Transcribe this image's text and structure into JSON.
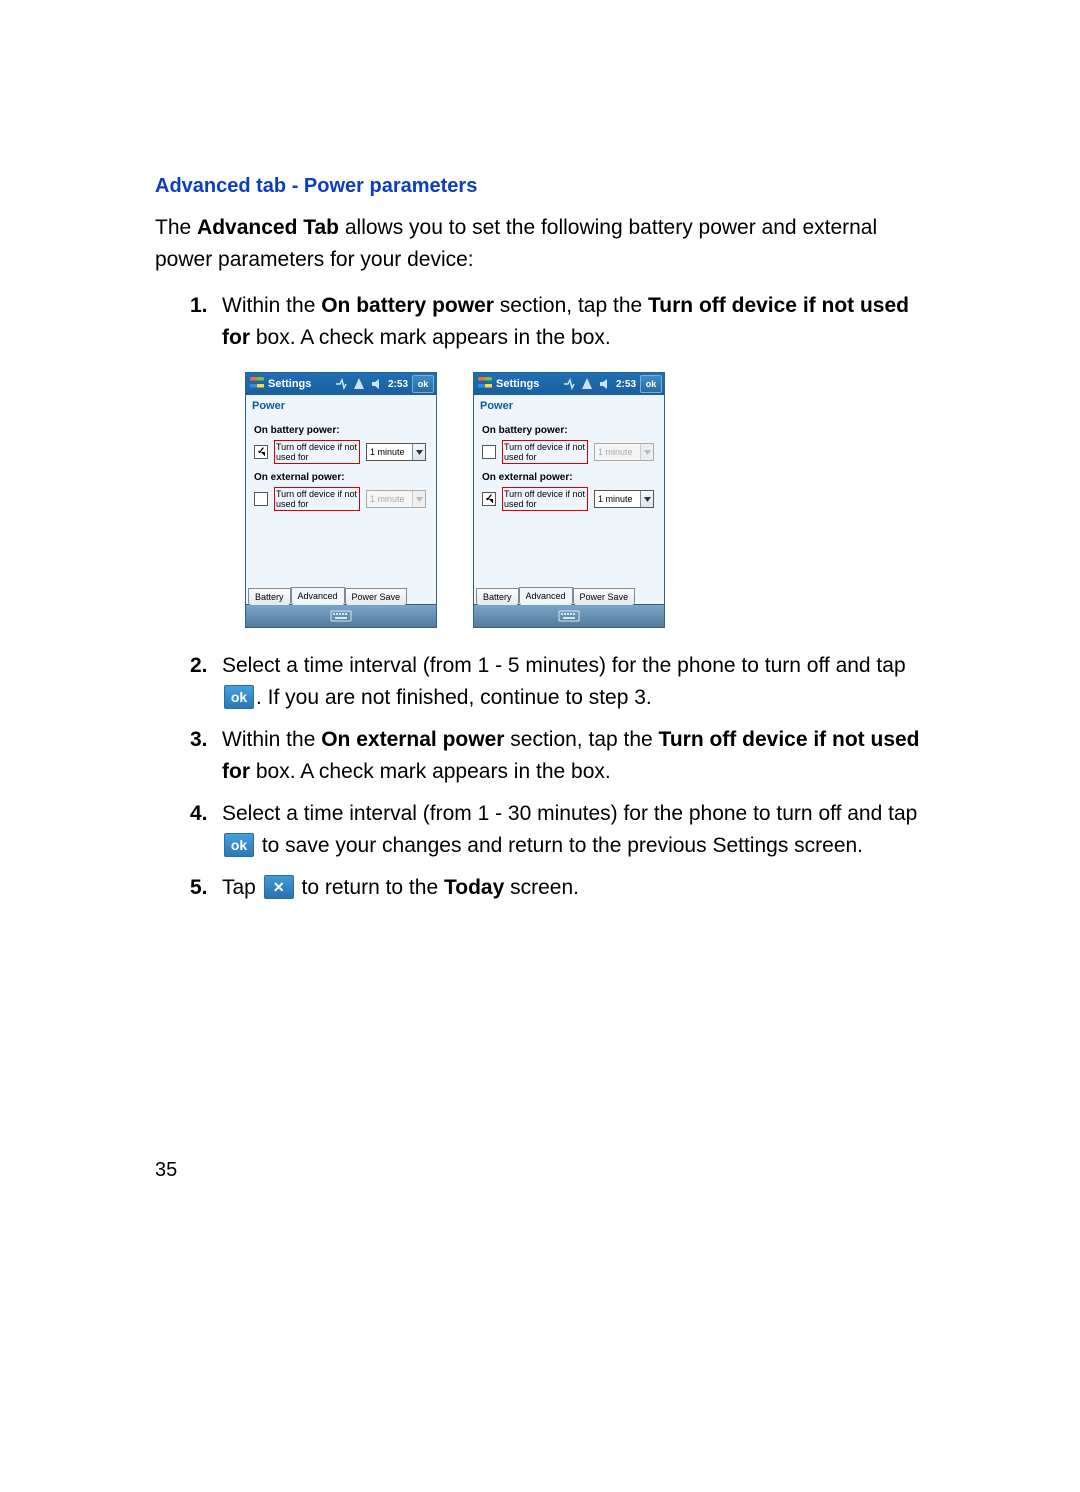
{
  "heading": "Advanced tab - Power parameters",
  "intro_pre": "The ",
  "intro_bold": "Advanced Tab",
  "intro_post": " allows you to set the following battery power and external power parameters for your device:",
  "steps": {
    "s1": {
      "num": "1.",
      "a": "Within the ",
      "b1": "On battery power",
      "c": " section, tap the ",
      "b2": "Turn off device if not used for",
      "d": " box. A check mark appears in the box."
    },
    "s2": {
      "num": "2.",
      "a": "Select a time interval (from 1 - 5 minutes) for the phone to turn off and tap ",
      "b": ". If you are not finished, continue to step 3."
    },
    "s3": {
      "num": "3.",
      "a": "Within the ",
      "b1": "On external power",
      "c": " section, tap the ",
      "b2": "Turn off device if not used for",
      "d": " box. A check mark appears in the box."
    },
    "s4": {
      "num": "4.",
      "a": "Select a time interval (from 1 - 30 minutes) for the phone to turn off and tap ",
      "b": " to save your changes and return to the previous Settings screen."
    },
    "s5": {
      "num": "5.",
      "a": "Tap ",
      "b": " to return to the ",
      "c": "Today",
      "d": " screen."
    }
  },
  "ok_label": "ok",
  "page_number": "35",
  "device": {
    "title": "Settings",
    "clock": "2:53",
    "ok": "ok",
    "subheader": "Power",
    "battery_group": "On battery power:",
    "external_group": "On external power:",
    "check_label": "Turn off device if not used for",
    "dd_value": "1 minute",
    "tabs": {
      "battery": "Battery",
      "advanced": "Advanced",
      "powersave": "Power Save"
    },
    "left": {
      "battery_checked": true,
      "external_checked": false,
      "battery_enabled": true,
      "external_enabled": false
    },
    "right": {
      "battery_checked": false,
      "external_checked": true,
      "battery_enabled": false,
      "external_enabled": true
    }
  }
}
